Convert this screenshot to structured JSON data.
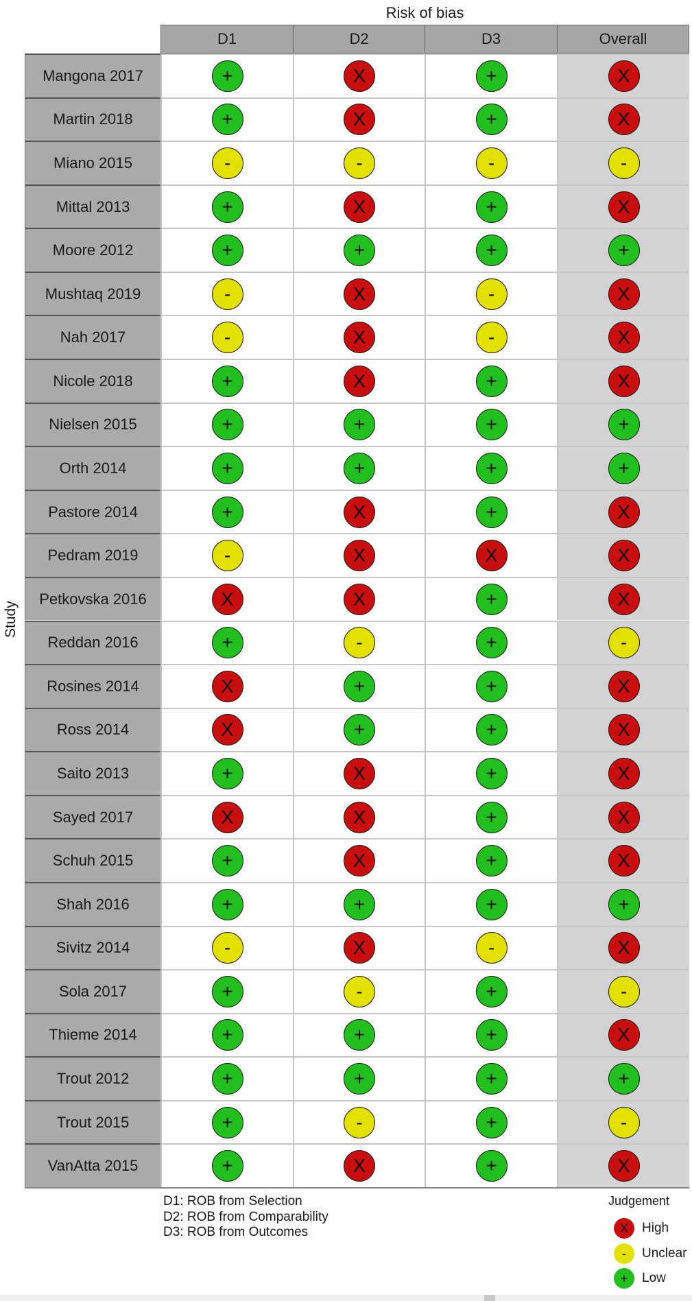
{
  "chart_data": {
    "type": "table",
    "title": "Risk of bias",
    "ylabel": "Study",
    "columns": [
      "D1",
      "D2",
      "D3",
      "Overall"
    ],
    "rows": [
      {
        "study": "Mangona 2017",
        "values": [
          "Low",
          "High",
          "Low",
          "High"
        ]
      },
      {
        "study": "Martin 2018",
        "values": [
          "Low",
          "High",
          "Low",
          "High"
        ]
      },
      {
        "study": "Miano 2015",
        "values": [
          "Unclear",
          "Unclear",
          "Unclear",
          "Unclear"
        ]
      },
      {
        "study": "Mittal 2013",
        "values": [
          "Low",
          "High",
          "Low",
          "High"
        ]
      },
      {
        "study": "Moore 2012",
        "values": [
          "Low",
          "Low",
          "Low",
          "Low"
        ]
      },
      {
        "study": "Mushtaq 2019",
        "values": [
          "Unclear",
          "High",
          "Unclear",
          "High"
        ]
      },
      {
        "study": "Nah 2017",
        "values": [
          "Unclear",
          "High",
          "Unclear",
          "High"
        ]
      },
      {
        "study": "Nicole 2018",
        "values": [
          "Low",
          "High",
          "Low",
          "High"
        ]
      },
      {
        "study": "Nielsen 2015",
        "values": [
          "Low",
          "Low",
          "Low",
          "Low"
        ]
      },
      {
        "study": "Orth 2014",
        "values": [
          "Low",
          "Low",
          "Low",
          "Low"
        ]
      },
      {
        "study": "Pastore 2014",
        "values": [
          "Low",
          "High",
          "Low",
          "High"
        ]
      },
      {
        "study": "Pedram 2019",
        "values": [
          "Unclear",
          "High",
          "High",
          "High"
        ]
      },
      {
        "study": "Petkovska 2016",
        "values": [
          "High",
          "High",
          "Low",
          "High"
        ]
      },
      {
        "study": "Reddan 2016",
        "values": [
          "Low",
          "Unclear",
          "Low",
          "Unclear"
        ]
      },
      {
        "study": "Rosines 2014",
        "values": [
          "High",
          "Low",
          "Low",
          "High"
        ]
      },
      {
        "study": "Ross 2014",
        "values": [
          "High",
          "Low",
          "Low",
          "High"
        ]
      },
      {
        "study": "Saito 2013",
        "values": [
          "Low",
          "High",
          "Low",
          "High"
        ]
      },
      {
        "study": "Sayed 2017",
        "values": [
          "High",
          "High",
          "Low",
          "High"
        ]
      },
      {
        "study": "Schuh 2015",
        "values": [
          "Low",
          "High",
          "Low",
          "High"
        ]
      },
      {
        "study": "Shah 2016",
        "values": [
          "Low",
          "Low",
          "Low",
          "Low"
        ]
      },
      {
        "study": "Sivitz 2014",
        "values": [
          "Unclear",
          "High",
          "Unclear",
          "High"
        ]
      },
      {
        "study": "Sola 2017",
        "values": [
          "Low",
          "Unclear",
          "Low",
          "Unclear"
        ]
      },
      {
        "study": "Thieme 2014",
        "values": [
          "Low",
          "Low",
          "Low",
          "High"
        ]
      },
      {
        "study": "Trout 2012",
        "values": [
          "Low",
          "Low",
          "Low",
          "Low"
        ]
      },
      {
        "study": "Trout 2015",
        "values": [
          "Low",
          "Unclear",
          "Low",
          "Unclear"
        ]
      },
      {
        "study": "VanAtta 2015",
        "values": [
          "Low",
          "High",
          "Low",
          "High"
        ]
      }
    ],
    "domain_notes": [
      "D1: ROB from Selection",
      "D2: ROB from Comparability",
      "D3: ROB from Outcomes"
    ],
    "legend": {
      "title": "Judgement",
      "placement": "bottom-right",
      "items": [
        {
          "label": "High",
          "symbol": "X",
          "color": "#c80e0e"
        },
        {
          "label": "Unclear",
          "symbol": "-",
          "color": "#e3e000"
        },
        {
          "label": "Low",
          "symbol": "+",
          "color": "#22bf1f"
        }
      ]
    }
  }
}
